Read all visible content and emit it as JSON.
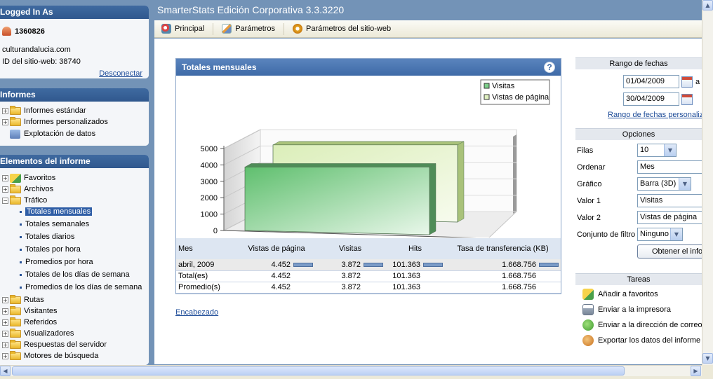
{
  "app": {
    "title": "SmarterStats Edición Corporativa 3.3.3220"
  },
  "login": {
    "heading": "Logged In As",
    "user": "1360826",
    "site": "culturandalucia.com",
    "site_id": "ID del sitio-web: 38740",
    "logout": "Desconectar"
  },
  "informes": {
    "heading": "Informes",
    "items": [
      "Informes estándar",
      "Informes personalizados",
      "Explotación de datos"
    ]
  },
  "elementos": {
    "heading": "Elementos del informe",
    "items": [
      "Favoritos",
      "Archivos",
      "Tráfico"
    ],
    "trafico_sub": [
      "Totales mensuales",
      "Totales semanales",
      "Totales diarios",
      "Totales por hora",
      "Promedios por hora",
      "Totales de los días de semana",
      "Promedios de los días de semana"
    ],
    "items_after": [
      "Rutas",
      "Visitantes",
      "Referidos",
      "Visualizadores",
      "Respuestas del servidor",
      "Motores de búsqueda"
    ]
  },
  "toolbar": {
    "principal": "Principal",
    "parametros": "Parámetros",
    "parametros_sitio": "Parámetros del sitio-web"
  },
  "chart_panel": {
    "title": "Totales mensuales",
    "help_symbol": "?"
  },
  "chart_data": {
    "type": "bar",
    "categories": [
      "abr 09"
    ],
    "series": [
      {
        "name": "Visitas",
        "values": [
          3872
        ]
      },
      {
        "name": "Vistas de página",
        "values": [
          4452
        ]
      }
    ],
    "yticks": [
      "0",
      "1000",
      "2000",
      "3000",
      "4000",
      "5000"
    ],
    "ylim": [
      0,
      5000
    ],
    "legend": "top-right",
    "colors": {
      "visitas": "#7ccf8a",
      "vistas": "#dff0c0"
    }
  },
  "table": {
    "headers": [
      "Mes",
      "Vistas de página",
      "Visitas",
      "Hits",
      "Tasa de transferencia (KB)"
    ],
    "rows": [
      [
        "abril, 2009",
        "4.452",
        "3.872",
        "101.363",
        "1.668.756"
      ],
      [
        "Total(es)",
        "4.452",
        "3.872",
        "101.363",
        "1.668.756"
      ],
      [
        "Promedio(s)",
        "4.452",
        "3.872",
        "101.363",
        "1.668.756"
      ]
    ]
  },
  "encabezado": "Encabezado",
  "rango": {
    "heading": "Rango de fechas",
    "start": "01/04/2009",
    "separator": "a",
    "end": "30/04/2009",
    "custom_link": "Rango de fechas personaliz"
  },
  "opciones": {
    "heading": "Opciones",
    "filas_label": "Filas",
    "filas_value": "10",
    "ordenar_label": "Ordenar",
    "ordenar_value": "Mes",
    "grafico_label": "Gráfico",
    "grafico_value": "Barra (3D)",
    "valor1_label": "Valor 1",
    "valor1_value": "Visitas",
    "valor2_label": "Valor 2",
    "valor2_value": "Vistas de página",
    "filtro_label": "Conjunto de filtro",
    "filtro_value": "Ninguno",
    "obtener_button": "Obtener el info"
  },
  "tareas": {
    "heading": "Tareas",
    "items": [
      "Añadir a favoritos",
      "Enviar a la impresora",
      "Enviar a la dirección de correo",
      "Exportar los datos del informe"
    ]
  }
}
